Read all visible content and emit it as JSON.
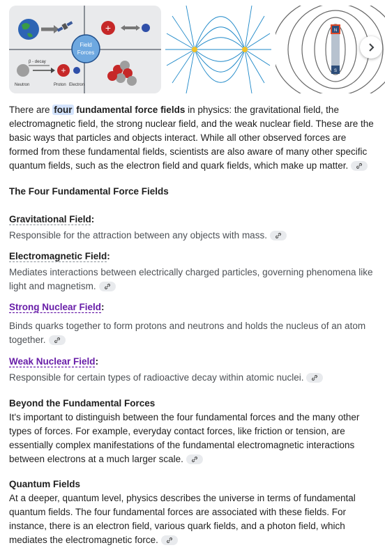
{
  "gallery": {
    "image1": {
      "center_label_line1": "Field",
      "center_label_line2": "Forces",
      "beta_label": "β - decay",
      "neutron_label": "Neutron",
      "proton_label": "Proton",
      "electron_label": "Electron"
    },
    "image3": {
      "north_label": "N",
      "south_label": "S"
    }
  },
  "intro": {
    "t1": "There are ",
    "highlight": "four",
    "t2": "fundamental force fields",
    "t3": " in physics: the gravitational field, the electromagnetic field, the strong nuclear field, and the weak nuclear field. These are the basic ways that particles and objects interact. While all other observed forces are formed from these fundamental fields, scientists are also aware of many other specific quantum fields, such as the electron field and quark fields, which make up matter."
  },
  "heading": "The Four Fundamental Force Fields",
  "fields": [
    {
      "title": "Gravitational Field",
      "desc": "Responsible for the attraction between any objects with mass."
    },
    {
      "title": "Electromagnetic Field",
      "desc": "Mediates interactions between electrically charged particles, governing phenomena like light and magnetism."
    },
    {
      "title": "Strong Nuclear Field",
      "desc": "Binds quarks together to form protons and neutrons and holds the nucleus of an atom together."
    },
    {
      "title": "Weak Nuclear Field",
      "desc": "Responsible for certain types of radioactive decay within atomic nuclei."
    }
  ],
  "beyond": {
    "title": "Beyond the Fundamental Forces",
    "text": "It's important to distinguish between the four fundamental forces and the many other types of forces. For example, everyday contact forces, like friction or tension, are essentially complex manifestations of the fundamental electromagnetic interactions between electrons at a much larger scale."
  },
  "quantum": {
    "title": "Quantum Fields",
    "text": "At a deeper, quantum level, physics describes the universe in terms of fundamental quantum fields. The four fundamental forces are associated with these fields. For instance, there is an electron field, various quark fields, and a photon field, which mediates the electromagnetic force."
  },
  "colon": ":",
  "icons": {
    "link": "link-icon",
    "next": "chevron-right-icon"
  }
}
